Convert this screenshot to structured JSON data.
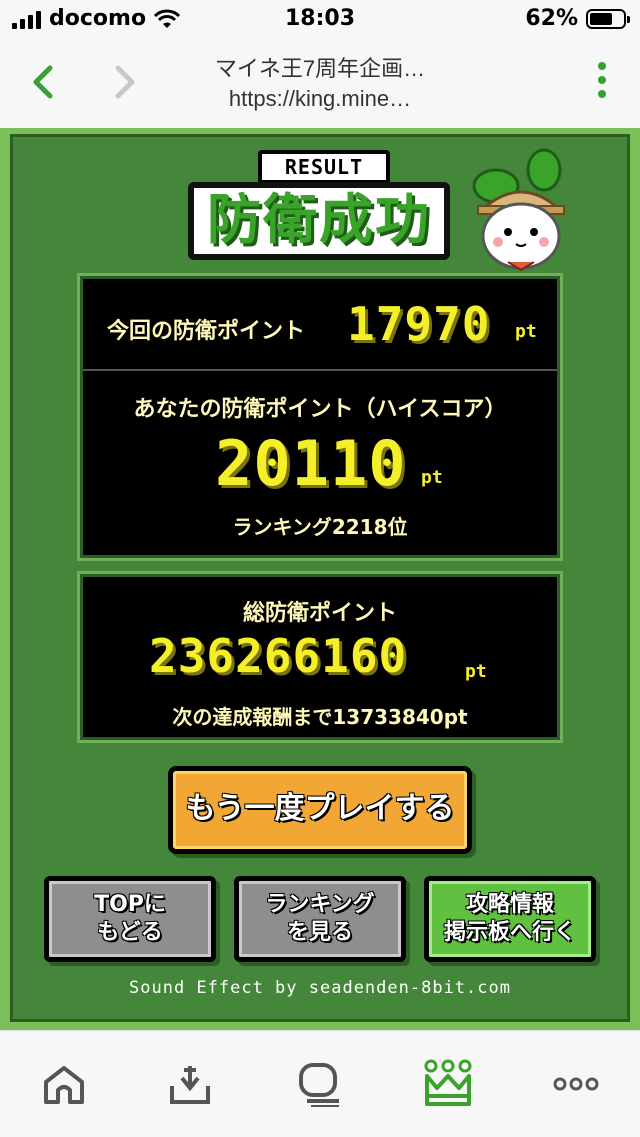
{
  "status_bar": {
    "carrier": "docomo",
    "time": "18:03",
    "battery": "62%"
  },
  "nav": {
    "title_line1": "マイネ王7周年企画…",
    "title_line2": "https://king.mine…"
  },
  "result": {
    "label": "RESULT",
    "headline": "防衛成功",
    "this_time_label": "今回の防衛ポイント",
    "this_time_value": "17970",
    "unit": "pt",
    "high_score_label": "あなたの防衛ポイント（ハイスコア）",
    "high_score_value": "20110",
    "ranking_text": "ランキング2218位",
    "total_label": "総防衛ポイント",
    "total_value": "236266160",
    "next_reward_text": "次の達成報酬まで13733840pt"
  },
  "buttons": {
    "play_again": "もう一度プレイする",
    "top": "TOPに\nもどる",
    "ranking": "ランキング\nを見る",
    "board": "攻略情報\n掲示板へ行く"
  },
  "credit": "Sound Effect by seadenden-8bit.com",
  "colors": {
    "accent": "#38a035",
    "bg_green": "#7bbf58",
    "score_yellow": "#f5ef2a",
    "button_orange": "#f2a735"
  },
  "toolbar_icons": [
    "home-icon",
    "share-icon",
    "tabs-icon",
    "crown-icon",
    "more-icon"
  ]
}
